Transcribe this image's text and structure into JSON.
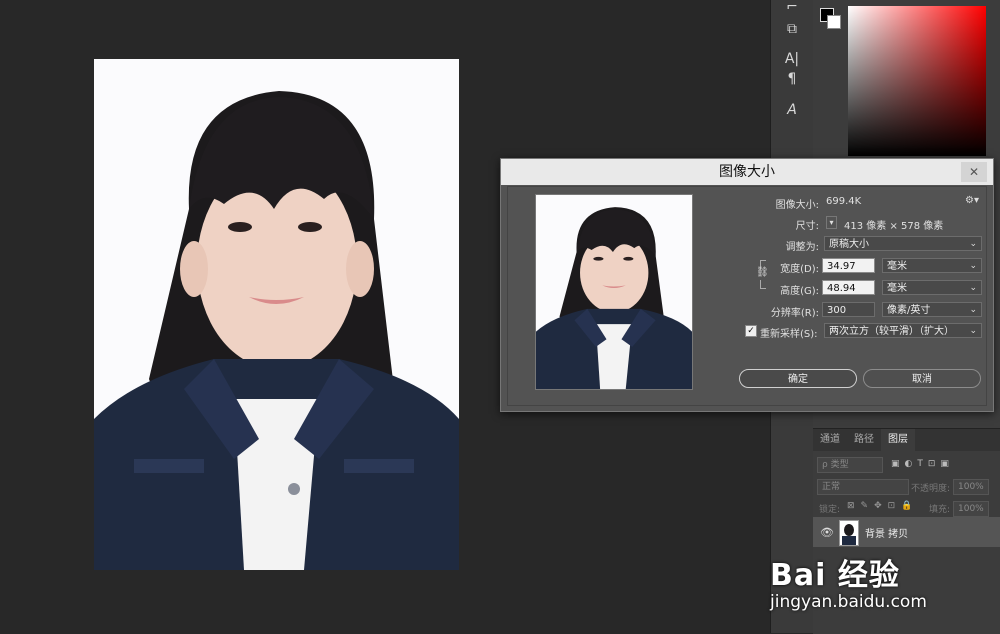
{
  "dialog": {
    "title": "图像大小",
    "close_icon": "close-icon",
    "image_size_label": "图像大小:",
    "image_size_value": "699.4K",
    "dimensions_label": "尺寸:",
    "dimensions_value": "413 像素  ×  578 像素",
    "fit_to_label": "调整为:",
    "fit_to_value": "原稿大小",
    "width_label": "宽度(D):",
    "width_value": "34.97",
    "width_unit": "毫米",
    "height_label": "高度(G):",
    "height_value": "48.94",
    "height_unit": "毫米",
    "resolution_label": "分辨率(R):",
    "resolution_value": "300",
    "resolution_unit": "像素/英寸",
    "resample_label": "重新采样(S):",
    "resample_checked": "✓",
    "resample_value": "两次立方（较平滑）（扩大）",
    "ok_label": "确定",
    "cancel_label": "取消"
  },
  "layers_panel": {
    "tabs": [
      "通道",
      "路径",
      "图层"
    ],
    "active_tab": "图层",
    "filter_label": "ρ 类型",
    "blend_mode": "正常",
    "opacity_label": "不透明度:",
    "opacity_value": "100%",
    "lock_label": "锁定:",
    "fill_label": "填充:",
    "fill_value": "100%",
    "layer_name": "背景 拷贝"
  },
  "tools": {
    "items": [
      "A|",
      "¶",
      "A"
    ]
  },
  "watermark": {
    "brand": "Bai 经验",
    "url": "jingyan.baidu.com"
  },
  "colors": {
    "workspace": "#282828",
    "panel": "#3c3c3c",
    "dialog": "#535353",
    "titlebar": "#e9e9e9",
    "denim": "#1f2a40"
  }
}
